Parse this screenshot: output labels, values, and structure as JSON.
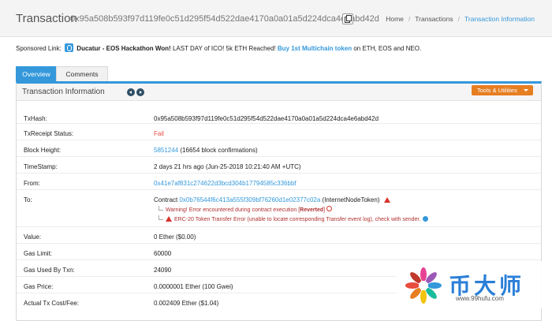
{
  "header": {
    "title": "Transaction",
    "hash": "0x95a508b593f97d119fe0c51d295f54d522dae4170a0a01a5d224dca4e6abd42d",
    "breadcrumb": [
      "Home",
      "Transactions",
      "Transaction Information"
    ]
  },
  "sponsor": {
    "prefix": "Sponsored Link:",
    "title": "Ducatur - EOS Hackathon Won!",
    "text": " LAST DAY of ICO! 5k ETH Reached! ",
    "link": "Buy 1st Multichain token",
    "suffix": " on ETH, EOS and NEO."
  },
  "tabs": [
    "Overview",
    "Comments"
  ],
  "panel": {
    "title": "Transaction Information",
    "tools_label": "Tools & Utilities"
  },
  "fields": {
    "txhash": {
      "label": "TxHash:",
      "value": "0x95a508b593f97d119fe0c51d295f54d522dae4170a0a01a5d224dca4e6abd42d"
    },
    "status": {
      "label": "TxReceipt Status:",
      "value": "Fail"
    },
    "block": {
      "label": "Block Height:",
      "value": "5851244",
      "extra": "(16654 block confirmations)"
    },
    "timestamp": {
      "label": "TimeStamp:",
      "value": "2 days 21 hrs ago (Jun-25-2018 10:21:40 AM +UTC)"
    },
    "from": {
      "label": "From:",
      "value": "0x41e7af831c274622d3bcd304b17794585c336bbf"
    },
    "to": {
      "label": "To:",
      "prefix": "Contract ",
      "address": "0x0b76544f6c413a555f309bf76260d1e02377c02a",
      "name": " (InternetNodeToken)",
      "warning1": "Warning! Error encountered during contract execution [",
      "reverted": "Reverted",
      "warning1_end": "]",
      "warning2": "ERC-20 Token Transfer Error (unable to locate corresponding Transfer event log), check with sender."
    },
    "value": {
      "label": "Value:",
      "value": "0 Ether ($0.00)"
    },
    "gas_limit": {
      "label": "Gas Limit:",
      "value": "60000"
    },
    "gas_used": {
      "label": "Gas Used By Txn:",
      "value": "24090"
    },
    "gas_price": {
      "label": "Gas Price:",
      "value": "0.0000001 Ether (100 Gwei)"
    },
    "cost": {
      "label": "Actual Tx Cost/Fee:",
      "value": "0.002409 Ether ($1.04)"
    }
  },
  "watermark": {
    "name": "币大师",
    "url": "www.99hufu.com"
  },
  "colors": {
    "accent": "#3498db",
    "tools": "#e67e22",
    "fail": "#e74c3c"
  }
}
